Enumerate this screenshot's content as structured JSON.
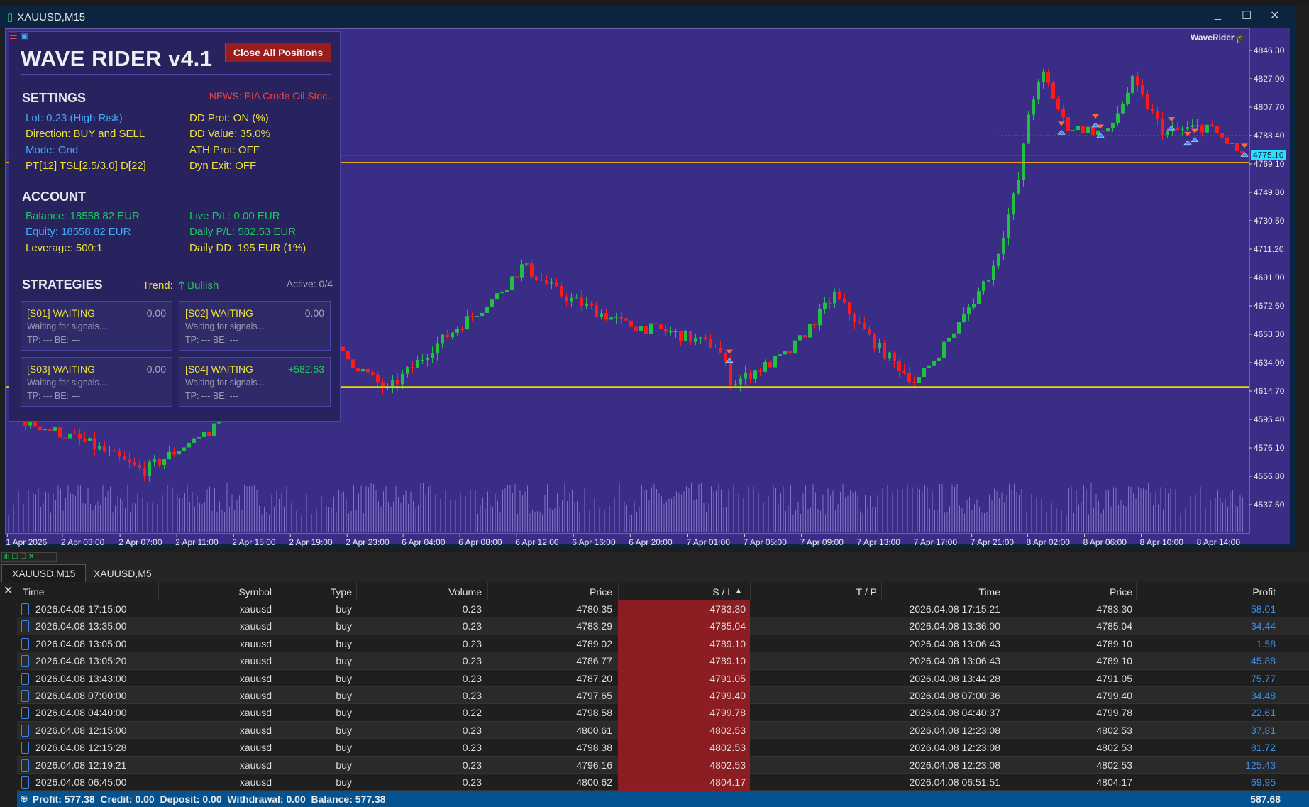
{
  "window": {
    "title": "XAUUSD,M15",
    "minimize": "_",
    "maximize": "☐",
    "close": "✕"
  },
  "chart": {
    "symbol": "XAUUSD",
    "timeframe": "M15",
    "indicator_label": "WaveRider",
    "current_price": "4775.10",
    "price_labels": [
      "4846.30",
      "4827.00",
      "4807.70",
      "4788.40",
      "4769.10",
      "4749.80",
      "4730.50",
      "4711.20",
      "4691.90",
      "4672.60",
      "4653.30",
      "4634.00",
      "4614.70",
      "4595.40",
      "4576.10",
      "4556.80",
      "4537.50"
    ],
    "time_labels": [
      "1 Apr 2026",
      "2 Apr 03:00",
      "2 Apr 07:00",
      "2 Apr 11:00",
      "2 Apr 15:00",
      "2 Apr 19:00",
      "2 Apr 23:00",
      "6 Apr 04:00",
      "6 Apr 08:00",
      "6 Apr 12:00",
      "6 Apr 16:00",
      "6 Apr 20:00",
      "7 Apr 01:00",
      "7 Apr 05:00",
      "7 Apr 09:00",
      "7 Apr 13:00",
      "7 Apr 17:00",
      "7 Apr 21:00",
      "8 Apr 02:00",
      "8 Apr 06:00",
      "8 Apr 10:00",
      "8 Apr 14:00"
    ],
    "levels": {
      "upper": 4769.1,
      "lower": 4617.5
    },
    "colors": {
      "background": "#3a2d86",
      "bull": "#22c042",
      "bear": "#ff1a1a",
      "level": "#e8d400",
      "current": "#28e0ff"
    }
  },
  "panel": {
    "title": "WAVE RIDER v4.1",
    "close_all": "Close All Positions",
    "settings_heading": "SETTINGS",
    "news": "NEWS: EIA Crude Oil Stoc..",
    "settings_left": [
      "Lot: 0.23 (High Risk)",
      "Direction: BUY and SELL",
      "Mode: Grid",
      "PT[12] TSL[2.5/3.0] D[22]"
    ],
    "settings_right": [
      "DD Prot: ON (%)",
      "DD Value: 35.0%",
      "ATH Prot: OFF",
      "Dyn Exit: OFF"
    ],
    "account_heading": "ACCOUNT",
    "account_left": [
      "Balance: 18558.82 EUR",
      "Equity: 18558.82 EUR",
      "Leverage: 500:1"
    ],
    "account_right": [
      "Live P/L: 0.00 EUR",
      "Daily P/L: 582.53 EUR",
      "Daily DD: 195 EUR (1%)"
    ],
    "strategies_heading": "STRATEGIES",
    "trend_label": "Trend:",
    "trend_value": "Bullish",
    "active": "Active: 0/4",
    "strategies": [
      {
        "name": "[S01] WAITING",
        "value": "0.00",
        "status": "Waiting for signals...",
        "tp": "TP: --- BE: ---"
      },
      {
        "name": "[S02] WAITING",
        "value": "0.00",
        "status": "Waiting for signals...",
        "tp": "TP: --- BE: ---"
      },
      {
        "name": "[S03] WAITING",
        "value": "0.00",
        "status": "Waiting for signals...",
        "tp": "TP: --- BE: ---"
      },
      {
        "name": "[S04] WAITING",
        "value": "+582.53",
        "status": "Waiting for signals...",
        "tp": "TP: --- BE: ---"
      }
    ]
  },
  "tabs": [
    "XAUUSD,M15",
    "XAUUSD,M5"
  ],
  "history": {
    "columns": [
      "Time",
      "Symbol",
      "Type",
      "Volume",
      "Price",
      "S / L",
      "T / P",
      "Time",
      "Price",
      "Profit"
    ],
    "sort_indicator": "▲",
    "rows": [
      [
        "2026.04.08 17:15:00",
        "xauusd",
        "buy",
        "0.23",
        "4780.35",
        "4783.30",
        "",
        "2026.04.08 17:15:21",
        "4783.30",
        "58.01"
      ],
      [
        "2026.04.08 13:35:00",
        "xauusd",
        "buy",
        "0.23",
        "4783.29",
        "4785.04",
        "",
        "2026.04.08 13:36:00",
        "4785.04",
        "34.44"
      ],
      [
        "2026.04.08 13:05:00",
        "xauusd",
        "buy",
        "0.23",
        "4789.02",
        "4789.10",
        "",
        "2026.04.08 13:06:43",
        "4789.10",
        "1.58"
      ],
      [
        "2026.04.08 13:05:20",
        "xauusd",
        "buy",
        "0.23",
        "4786.77",
        "4789.10",
        "",
        "2026.04.08 13:06:43",
        "4789.10",
        "45.88"
      ],
      [
        "2026.04.08 13:43:00",
        "xauusd",
        "buy",
        "0.23",
        "4787.20",
        "4791.05",
        "",
        "2026.04.08 13:44:28",
        "4791.05",
        "75.77"
      ],
      [
        "2026.04.08 07:00:00",
        "xauusd",
        "buy",
        "0.23",
        "4797.65",
        "4799.40",
        "",
        "2026.04.08 07:00:36",
        "4799.40",
        "34.48"
      ],
      [
        "2026.04.08 04:40:00",
        "xauusd",
        "buy",
        "0.22",
        "4798.58",
        "4799.78",
        "",
        "2026.04.08 04:40:37",
        "4799.78",
        "22.61"
      ],
      [
        "2026.04.08 12:15:00",
        "xauusd",
        "buy",
        "0.23",
        "4800.61",
        "4802.53",
        "",
        "2026.04.08 12:23:08",
        "4802.53",
        "37.81"
      ],
      [
        "2026.04.08 12:15:28",
        "xauusd",
        "buy",
        "0.23",
        "4798.38",
        "4802.53",
        "",
        "2026.04.08 12:23:08",
        "4802.53",
        "81.72"
      ],
      [
        "2026.04.08 12:19:21",
        "xauusd",
        "buy",
        "0.23",
        "4796.16",
        "4802.53",
        "",
        "2026.04.08 12:23:08",
        "4802.53",
        "125.43"
      ],
      [
        "2026.04.08 06:45:00",
        "xauusd",
        "buy",
        "0.23",
        "4800.62",
        "4804.17",
        "",
        "2026.04.08 06:51:51",
        "4804.17",
        "69.95"
      ]
    ],
    "footer": "Profit: 577.38  Credit: 0.00  Deposit: 0.00  Withdrawal: 0.00  Balance: 577.38",
    "footer_total": "587.68"
  }
}
